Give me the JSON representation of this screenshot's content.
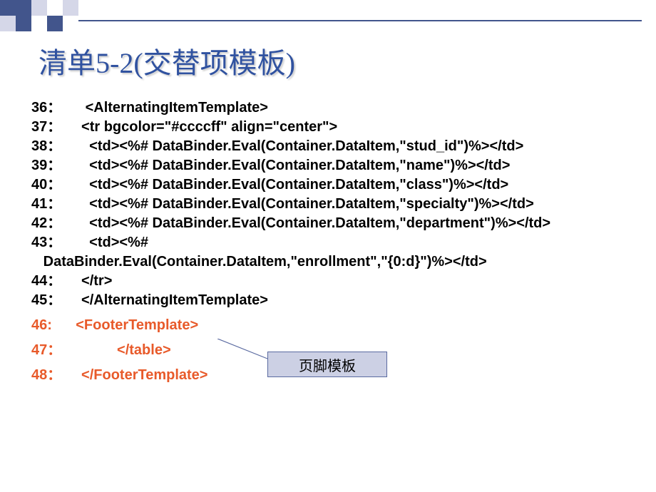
{
  "title": "清单5-2(交替项模板)",
  "lines": [
    {
      "n": "36：",
      "c": "      <AlternatingItemTemplate>",
      "red": false
    },
    {
      "n": "37：",
      "c": "     <tr bgcolor=\"#ccccff\" align=\"center\">",
      "red": false
    },
    {
      "n": "38：",
      "c": "       <td><%# DataBinder.Eval(Container.DataItem,\"stud_id\")%></td>",
      "red": false
    },
    {
      "n": "39：",
      "c": "       <td><%# DataBinder.Eval(Container.DataItem,\"name\")%></td>",
      "red": false
    },
    {
      "n": "40：",
      "c": "       <td><%# DataBinder.Eval(Container.DataItem,\"class\")%></td>",
      "red": false
    },
    {
      "n": "41：",
      "c": "       <td><%# DataBinder.Eval(Container.DataItem,\"specialty\")%></td>",
      "red": false
    },
    {
      "n": "42：",
      "c": "       <td><%# DataBinder.Eval(Container.DataItem,\"department\")%></td>",
      "red": false
    },
    {
      "n": "43：",
      "c": "       <td><%# \n   DataBinder.Eval(Container.DataItem,\"enrollment\",\"{0:d}\")%></td>",
      "red": false
    },
    {
      "n": "44：",
      "c": "     </tr>",
      "red": false
    },
    {
      "n": "45：",
      "c": "     </AlternatingItemTemplate>",
      "red": false
    },
    {
      "n": "46:",
      "c": "      <FooterTemplate>",
      "red": true
    },
    {
      "n": "47：",
      "c": "              </table>",
      "red": true
    },
    {
      "n": "48：",
      "c": "     </FooterTemplate>",
      "red": true
    }
  ],
  "callout": "页脚模板"
}
